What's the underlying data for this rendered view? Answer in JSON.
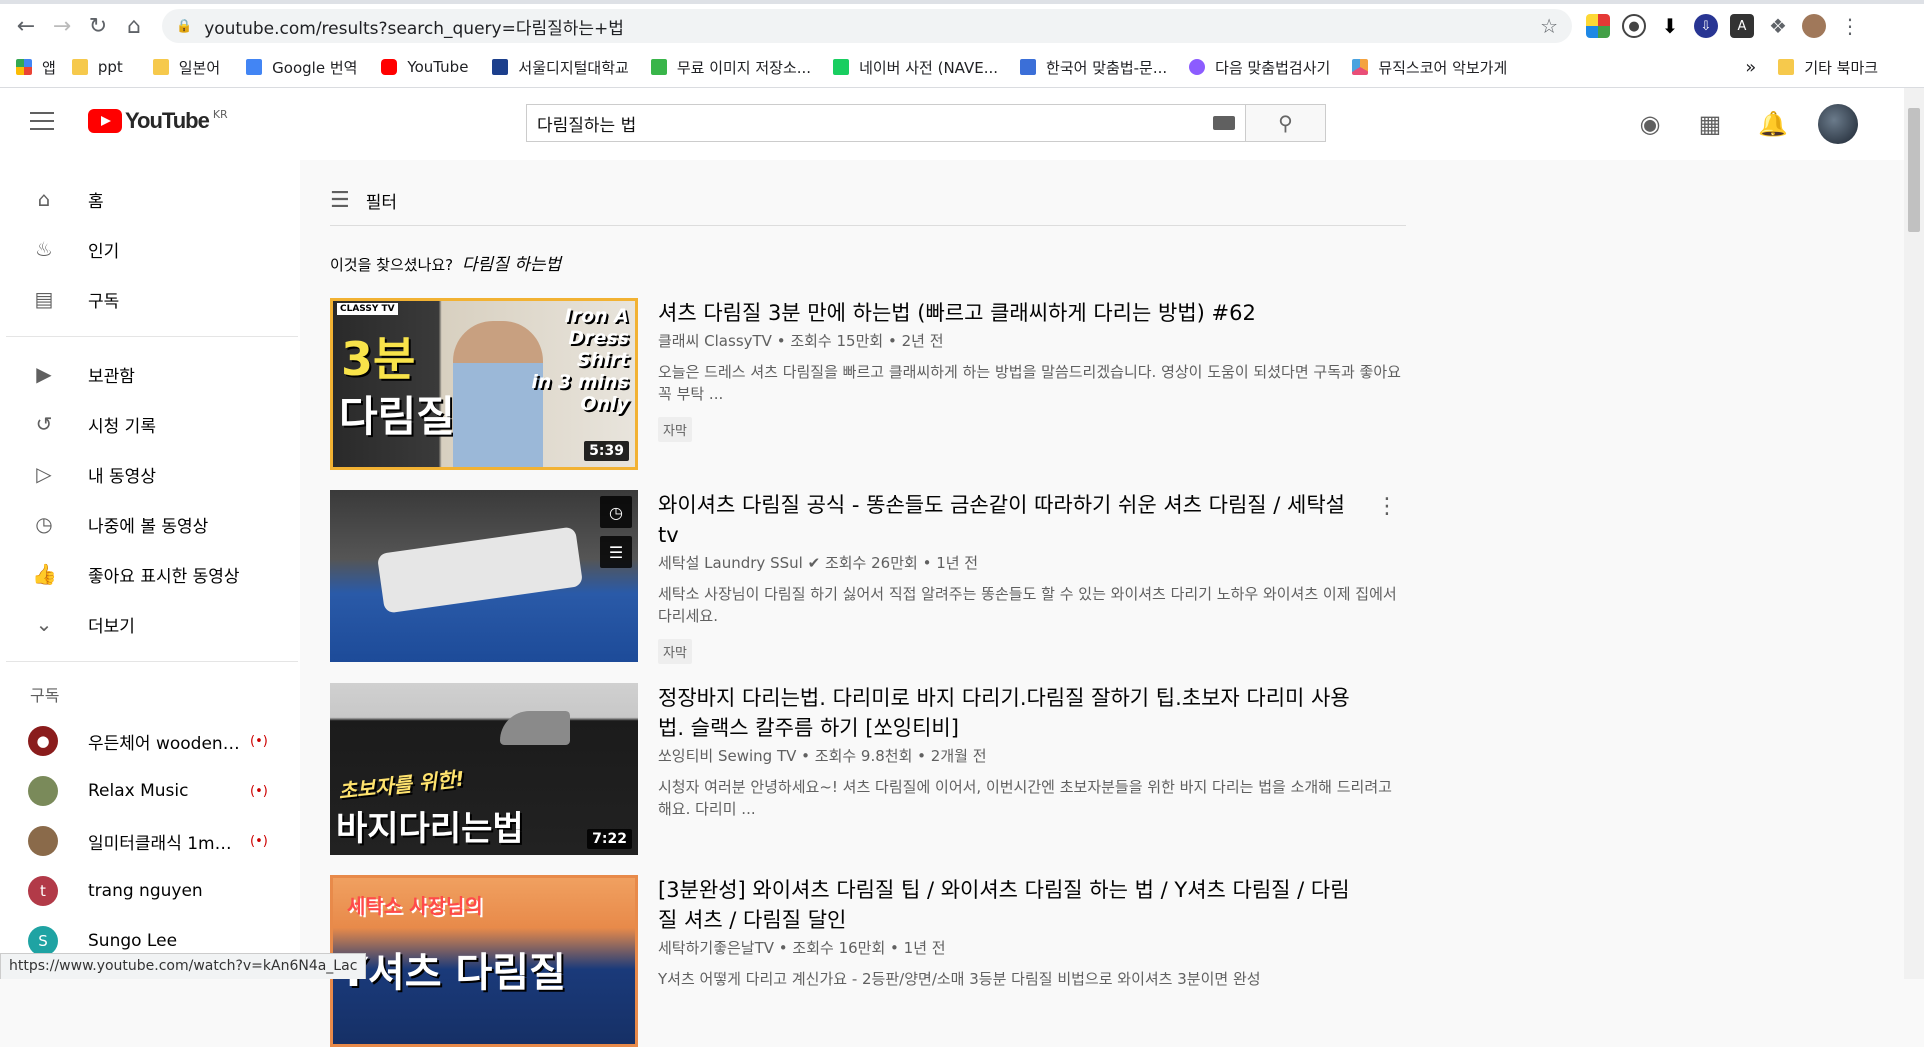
{
  "browser": {
    "url": "youtube.com/results?search_query=다림질하는+법",
    "bookmarks": [
      {
        "label": "앱",
        "kind": "apps"
      },
      {
        "label": "ppt",
        "kind": "folder"
      },
      {
        "label": "일본어",
        "kind": "folder"
      },
      {
        "label": "Google 번역",
        "kind": "translate"
      },
      {
        "label": "YouTube",
        "kind": "youtube"
      },
      {
        "label": "서울디지털대학교",
        "kind": "sdu"
      },
      {
        "label": "무료 이미지 저장소...",
        "kind": "px"
      },
      {
        "label": "네이버 사전 (NAVE...",
        "kind": "naver"
      },
      {
        "label": "한국어 맞춤법-문...",
        "kind": "spell"
      },
      {
        "label": "다음 맞춤법검사기",
        "kind": "daum"
      },
      {
        "label": "뮤직스코어 악보가게",
        "kind": "music"
      }
    ],
    "more_bookmarks": "»",
    "other_bookmarks": "기타 북마크",
    "status_url": "https://www.youtube.com/watch?v=kAn6N4a_Lac"
  },
  "youtube": {
    "logo_text": "YouTube",
    "logo_region": "KR",
    "search_query": "다림질하는 법"
  },
  "sidebar": {
    "main_items": [
      {
        "label": "홈",
        "icon": "home-icon"
      },
      {
        "label": "인기",
        "icon": "trending-icon"
      },
      {
        "label": "구독",
        "icon": "subscriptions-icon"
      }
    ],
    "library_items": [
      {
        "label": "보관함",
        "icon": "library-icon"
      },
      {
        "label": "시청 기록",
        "icon": "history-icon"
      },
      {
        "label": "내 동영상",
        "icon": "your-videos-icon"
      },
      {
        "label": "나중에 볼 동영상",
        "icon": "watch-later-icon"
      },
      {
        "label": "좋아요 표시한 동영상",
        "icon": "liked-icon"
      },
      {
        "label": "더보기",
        "icon": "chevron-down-icon"
      }
    ],
    "subscriptions_heading": "구독",
    "subscriptions": [
      {
        "name": "우든체어 wooden ...",
        "live": true,
        "avatar_color": "#8a1c1c"
      },
      {
        "name": "Relax Music",
        "live": true,
        "avatar_color": "#7a8a5a"
      },
      {
        "name": "일미터클래식 1mC...",
        "live": true,
        "avatar_color": "#8a6a4a"
      },
      {
        "name": "trang nguyen",
        "live": false,
        "avatar_color": "#b23a48",
        "initial": "t"
      },
      {
        "name": "Sungo Lee",
        "live": false,
        "avatar_color": "#1fa3a3",
        "initial": "S"
      }
    ]
  },
  "results": {
    "filter_label": "필터",
    "did_you_mean_label": "이것을 찾으셨나요?",
    "did_you_mean_query": "다림질 하는법",
    "videos": [
      {
        "title": "셔츠 다림질 3분 만에 하는법 (빠르고 클래씨하게 다리는 방법) #62",
        "channel": "클래씨 ClassyTV",
        "views": "조회수 15만회",
        "age": "2년 전",
        "description": "오늘은 드레스 셔츠 다림질을 빠르고 클래씨하게 하는 방법을 말씀드리겠습니다. 영상이 도움이 되셨다면 구독과 좋아요 꼭 부탁 ...",
        "badge": "자막",
        "duration": "5:39",
        "thumb_text": [
          "3분",
          "다림질"
        ],
        "thumb_text_right": [
          "Iron A",
          "Dress",
          "Shirt",
          "in 3 mins",
          "Only"
        ],
        "thumb_logo": "CLASSY TV"
      },
      {
        "title": "와이셔츠 다림질 공식 - 똥손들도 금손같이 따라하기 쉬운 셔츠 다림질 / 세탁설tv",
        "channel": "세탁설 Laundry SSul",
        "verified": true,
        "views": "조회수 26만회",
        "age": "1년 전",
        "description": "세탁소 사장님이 다림질 하기 싫어서 직접 알려주는 똥손들도 할 수 있는 와이셔츠 다리기 노하우 와이셔츠 이제 집에서다리세요.",
        "badge": "자막"
      },
      {
        "title": "정장바지 다리는법. 다리미로 바지 다리기.다림질 잘하기 팁.초보자 다리미 사용법. 슬랙스 칼주름 하기 [쏘잉티비]",
        "channel": "쏘잉티비 Sewing TV",
        "views": "조회수 9.8천회",
        "age": "2개월 전",
        "description": "시청자 여러분 안녕하세요~! 셔츠 다림질에 이어서, 이번시간엔 초보자분들을 위한 바지 다리는 법을 소개해 드리려고 해요. 다리미 ...",
        "duration": "7:22",
        "thumb_text": [
          "초보자를 위한!",
          "바지다리는법"
        ]
      },
      {
        "title": "[3분완성] 와이셔츠 다림질 팁 / 와이셔츠 다림질 하는 법 / Y셔츠 다림질 / 다림질 셔츠 / 다림질 달인",
        "channel": "세탁하기좋은날TV",
        "views": "조회수 16만회",
        "age": "1년 전",
        "description": "Y셔츠 어떻게 다리고 계신가요 - 2등판/양면/소매 3등분 다림질 비법으로 와이셔츠 3분이면 완성",
        "thumb_text": [
          "세탁소 사장님의",
          "Y셔츠 다림질"
        ]
      }
    ]
  },
  "colors": {
    "youtube_red": "#ff0000",
    "live_red": "#cc0000",
    "thumb1_border": "#f2b233"
  }
}
